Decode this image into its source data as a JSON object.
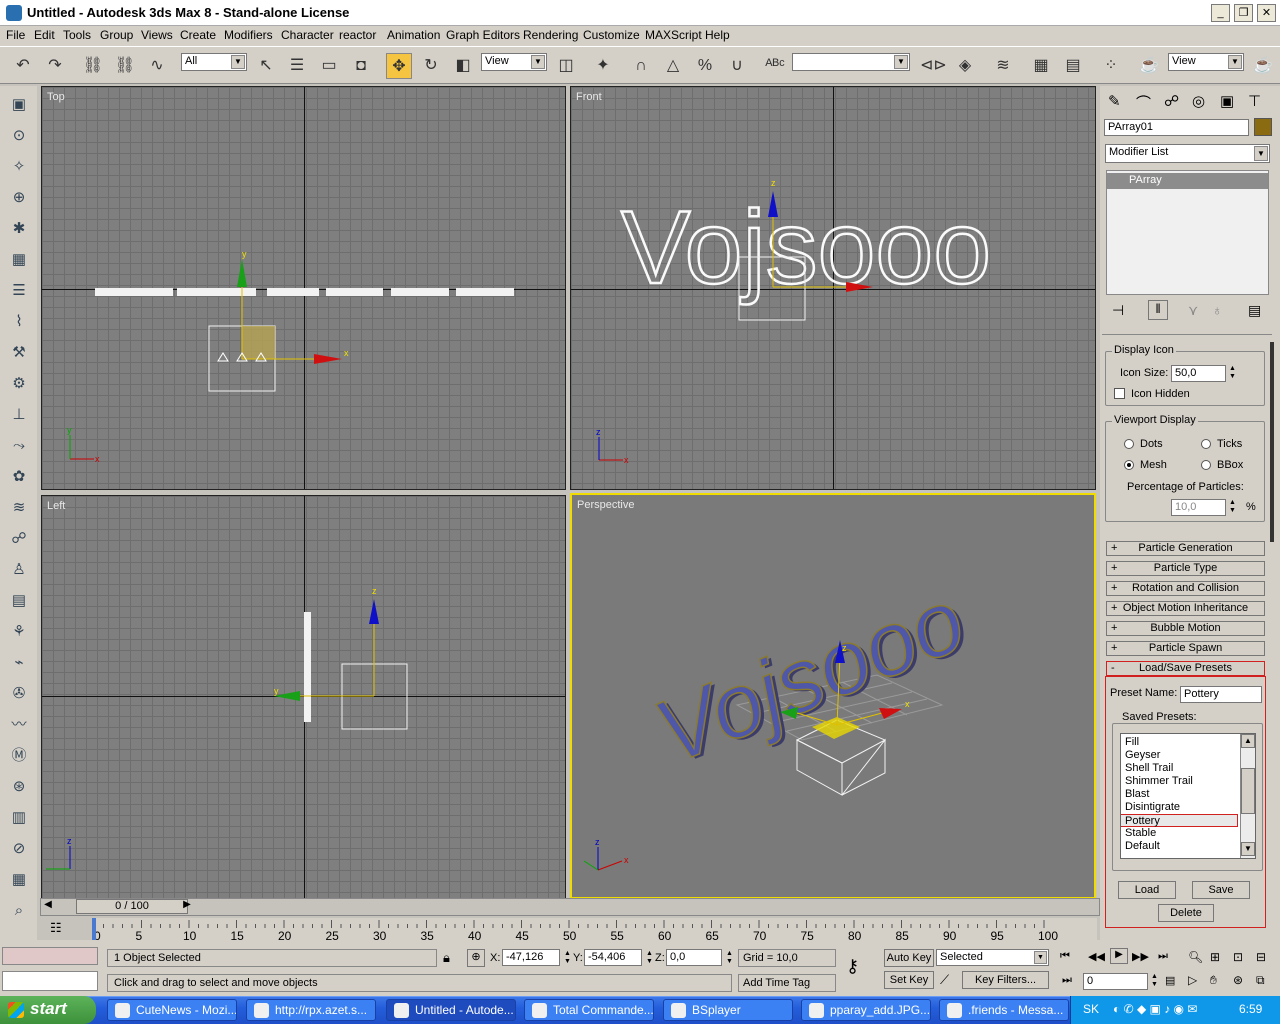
{
  "window": {
    "title": "Untitled - Autodesk 3ds Max 8  - Stand-alone License"
  },
  "menu": [
    "File",
    "Edit",
    "Tools",
    "Group",
    "Views",
    "Create",
    "Modifiers",
    "Character",
    "reactor",
    "Animation",
    "Graph Editors",
    "Rendering",
    "Customize",
    "MAXScript",
    "Help"
  ],
  "toolbar": {
    "selection_filter": "All",
    "ref_coord": "View",
    "named_selection": "",
    "render_view": "View"
  },
  "viewports": {
    "top": "Top",
    "front": "Front",
    "left": "Left",
    "perspective": "Perspective"
  },
  "scene": {
    "text": "Vojsooo"
  },
  "axis": {
    "x": "x",
    "y": "y",
    "z": "z"
  },
  "panel": {
    "object_name": "PArray01",
    "object_color": "#8b6b12",
    "modifier_list": "Modifier List",
    "stack_item": "PArray",
    "display_icon": {
      "title": "Display Icon",
      "icon_size_label": "Icon Size:",
      "icon_size": "50,0",
      "icon_hidden": "Icon Hidden"
    },
    "viewport_display": {
      "title": "Viewport Display",
      "dots": "Dots",
      "ticks": "Ticks",
      "mesh": "Mesh",
      "bbox": "BBox",
      "percentage_label": "Percentage of Particles:",
      "percentage": "10,0",
      "pct": "%"
    },
    "rollouts": [
      {
        "sign": "+",
        "label": "Particle Generation"
      },
      {
        "sign": "+",
        "label": "Particle Type"
      },
      {
        "sign": "+",
        "label": "Rotation and Collision"
      },
      {
        "sign": "+",
        "label": "Object Motion Inheritance"
      },
      {
        "sign": "+",
        "label": "Bubble Motion"
      },
      {
        "sign": "+",
        "label": "Particle Spawn"
      },
      {
        "sign": "-",
        "label": "Load/Save Presets"
      }
    ],
    "presets": {
      "preset_name_label": "Preset Name:",
      "preset_name": "Pottery",
      "saved_label": "Saved Presets:",
      "items": [
        "Fill",
        "Geyser",
        "Shell Trail",
        "Shimmer Trail",
        "Blast",
        "Disintigrate",
        "Pottery",
        "Stable",
        "Default"
      ],
      "selected": "Pottery",
      "load": "Load",
      "save": "Save",
      "delete": "Delete"
    }
  },
  "timeline": {
    "frame": "0 / 100",
    "ticks": [
      "0",
      "5",
      "10",
      "15",
      "20",
      "25",
      "30",
      "35",
      "40",
      "45",
      "50",
      "55",
      "60",
      "65",
      "70",
      "75",
      "80",
      "85",
      "90",
      "95",
      "100"
    ]
  },
  "status": {
    "selection": "1 Object Selected",
    "prompt": "Click and drag to select and move objects",
    "x_label": "X:",
    "x": "-47,126",
    "y_label": "Y:",
    "y": "-54,406",
    "z_label": "Z:",
    "z": "0,0",
    "grid": "Grid = 10,0",
    "add_time_tag": "Add Time Tag",
    "auto_key": "Auto Key",
    "set_key": "Set Key",
    "key_mode": "Selected",
    "key_filters": "Key Filters...",
    "frame_field": "0"
  },
  "taskbar": {
    "start": "start",
    "tasks": [
      "CuteNews - Mozi...",
      "http://rpx.azet.s...",
      "Untitled - Autode...",
      "Total Commande...",
      "BSplayer",
      "pparay_add.JPG...",
      ".friends - Messa..."
    ],
    "lang": "SK",
    "clock": "6:59"
  }
}
